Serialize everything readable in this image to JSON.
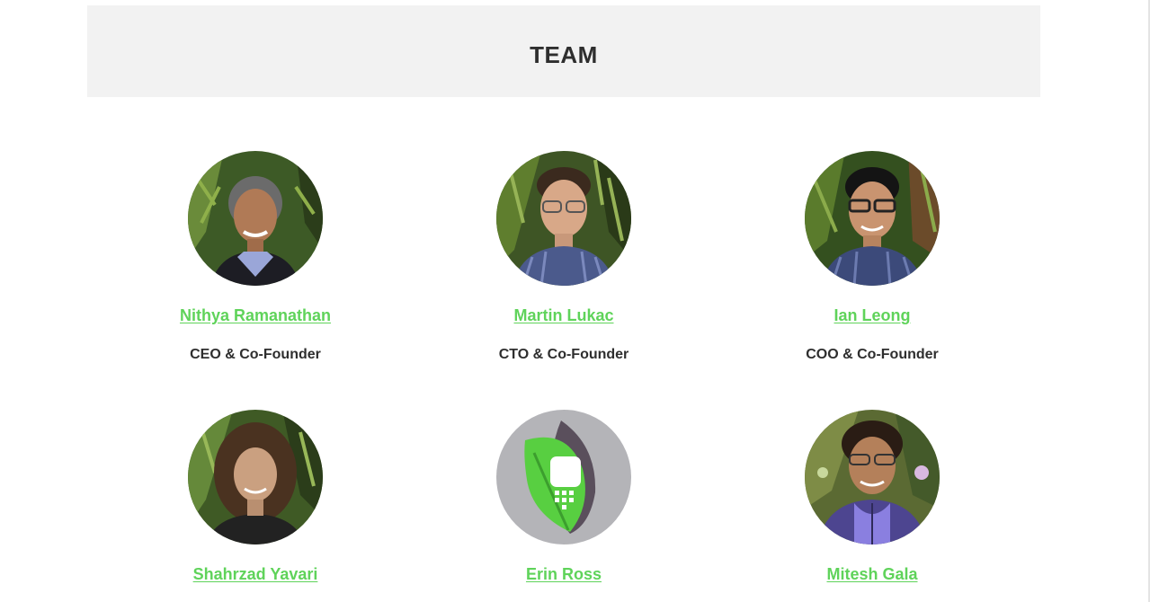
{
  "section": {
    "title": "TEAM"
  },
  "members": [
    {
      "name": "Nithya Ramanathan",
      "role": "CEO & Co-Founder",
      "avatar": "photo-woman-short-gray-hair"
    },
    {
      "name": "Martin Lukac",
      "role": "CTO & Co-Founder",
      "avatar": "photo-man-glasses-plaid-shirt"
    },
    {
      "name": "Ian Leong",
      "role": "COO & Co-Founder",
      "avatar": "photo-man-glasses-plaid-shirt"
    },
    {
      "name": "Shahrzad Yavari",
      "role": "",
      "avatar": "photo-woman-curly-hair"
    },
    {
      "name": "Erin Ross",
      "role": "",
      "avatar": "placeholder-leaf-phone-logo"
    },
    {
      "name": "Mitesh Gala",
      "role": "",
      "avatar": "photo-man-glasses-purple-jacket"
    }
  ],
  "colors": {
    "link_green": "#5fd35a",
    "header_bg": "#f2f2f2",
    "text_dark": "#2e2e2e",
    "placeholder_bg": "#b4b4b8"
  }
}
